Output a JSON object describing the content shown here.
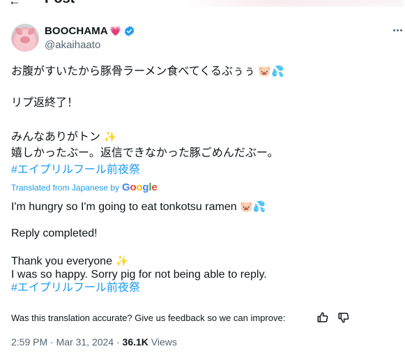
{
  "header": {
    "title": "Post"
  },
  "author": {
    "display_name": "BOOCHAMA",
    "name_emoji": "💗",
    "handle": "@akaihaato",
    "verified_icon": "verified-badge-icon",
    "brand_color": "#1d9bf0"
  },
  "tweet": {
    "original": {
      "line1": "お腹がすいたから豚骨ラーメン食べてくるぶぅぅ",
      "line1_emoji": "🐷💦",
      "line2": "リプ返終了！",
      "line3": "みんなありがトン",
      "line3_emoji": "✨",
      "line4": "嬉しかったぶー。返信できなかった豚ごめんだぶー。",
      "hashtag": "#エイプリルフール前夜祭"
    },
    "translated_label": "Translated from Japanese by",
    "google_logo_text": "Google",
    "translation": {
      "line1": "I'm hungry so I'm going to eat tonkotsu ramen",
      "line1_emoji": "🐷💦",
      "line2": "Reply completed!",
      "line3": "Thank you everyone",
      "line3_emoji": "✨",
      "line4": "I was so happy. Sorry pig for not being able to reply.",
      "hashtag": "#エイプリルフール前夜祭"
    }
  },
  "feedback": {
    "text": "Was this translation accurate? Give us feedback so we can improve:",
    "thumbs_up_icon": "thumbs-up-icon",
    "thumbs_down_icon": "thumbs-down-icon"
  },
  "meta": {
    "time": "2:59 PM",
    "date": "Mar 31, 2024",
    "separator": "·",
    "views_count": "36.1K",
    "views_label": "Views"
  }
}
